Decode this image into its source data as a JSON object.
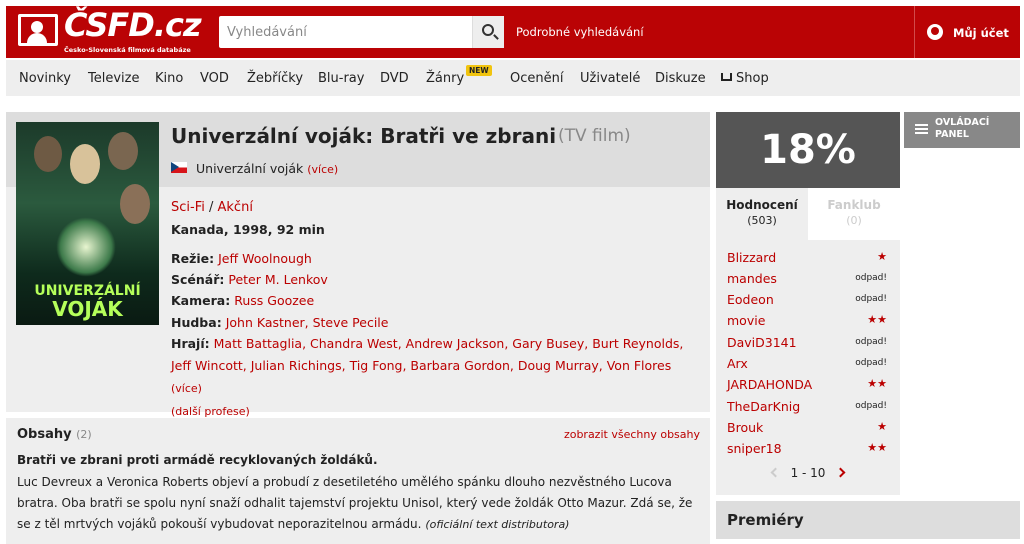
{
  "header": {
    "logo_text": "ČSFD.cz",
    "logo_subtitle": "Česko-Slovenská filmová databáze",
    "search_placeholder": "Vyhledávání",
    "advanced_search": "Podrobné vyhledávání",
    "account": "Můj účet",
    "brand_color": "#ba0305"
  },
  "nav": {
    "items": [
      "Novinky",
      "Televize",
      "Kino",
      "VOD",
      "Žebříčky",
      "Blu-ray",
      "DVD",
      "Žánry",
      "Ocenění",
      "Uživatelé",
      "Diskuze",
      "Shop"
    ],
    "new_badge": "NEW"
  },
  "film": {
    "title": "Univerzální voják: Bratři ve zbrani",
    "type": "(TV film)",
    "alt_name": "Univerzální voják",
    "alt_more": "(více)",
    "poster_title_line1": "UNIVERZÁLNÍ",
    "poster_title_line2": "VOJÁK",
    "genres": [
      "Sci-Fi",
      "Akční"
    ],
    "genre_sep": " / ",
    "origin": "Kanada, 1998, 92 min",
    "crew": [
      {
        "role": "Režie:",
        "names": "Jeff Woolnough"
      },
      {
        "role": "Scénář:",
        "names": "Peter M. Lenkov"
      },
      {
        "role": "Kamera:",
        "names": "Russ Goozee"
      },
      {
        "role": "Hudba:",
        "names": "John Kastner, Steve Pecile"
      }
    ],
    "cast_label": "Hrají:",
    "cast": "Matt Battaglia, Chandra West, Andrew Jackson, Gary Busey, Burt Reynolds, Jeff Wincott, Julian Richings, Tig Fong, Barbara Gordon, Doug Murray, Von Flores",
    "cast_more": "(více)",
    "more_professions": "(další profese)"
  },
  "plot": {
    "heading": "Obsahy",
    "count": "(2)",
    "show_all": "zobrazit všechny obsahy",
    "lead": "Bratři ve zbrani proti armádě recyklovaných žoldáků.",
    "text": "Luc Devreux a Veronica Roberts objeví a probudí z desetiletého umělého spánku dlouho nezvěstného Lucova bratra. Oba bratři se spolu nyní snaží odhalit tajemství projektu Unisol, který vede žoldák Otto Mazur. Zdá se, že se z těl mrtvých vojáků pokouší vybudovat neporazitelnou armádu.",
    "source": "(oficiální text distributora)"
  },
  "rating": {
    "value": "18%",
    "tab_ratings": "Hodnocení",
    "tab_ratings_count": "(503)",
    "tab_fanclub": "Fanklub",
    "tab_fanclub_count": "(0)",
    "users": [
      {
        "name": "Blizzard",
        "stars": "★",
        "text": ""
      },
      {
        "name": "mandes",
        "stars": "",
        "text": "odpad!"
      },
      {
        "name": "Eodeon",
        "stars": "",
        "text": "odpad!"
      },
      {
        "name": "movie",
        "stars": "★★",
        "text": ""
      },
      {
        "name": "DaviD3141",
        "stars": "",
        "text": "odpad!"
      },
      {
        "name": "Arx",
        "stars": "",
        "text": "odpad!"
      },
      {
        "name": "JARDAHONDA",
        "stars": "★★",
        "text": ""
      },
      {
        "name": "TheDarKnig",
        "stars": "",
        "text": "odpad!"
      },
      {
        "name": "Brouk",
        "stars": "★",
        "text": ""
      },
      {
        "name": "sniper18",
        "stars": "★★",
        "text": ""
      }
    ],
    "pager": "1 - 10"
  },
  "panel": {
    "label_line1": "OVLÁDACÍ",
    "label_line2": "PANEL"
  },
  "premiery": {
    "label": "Premiéry"
  }
}
